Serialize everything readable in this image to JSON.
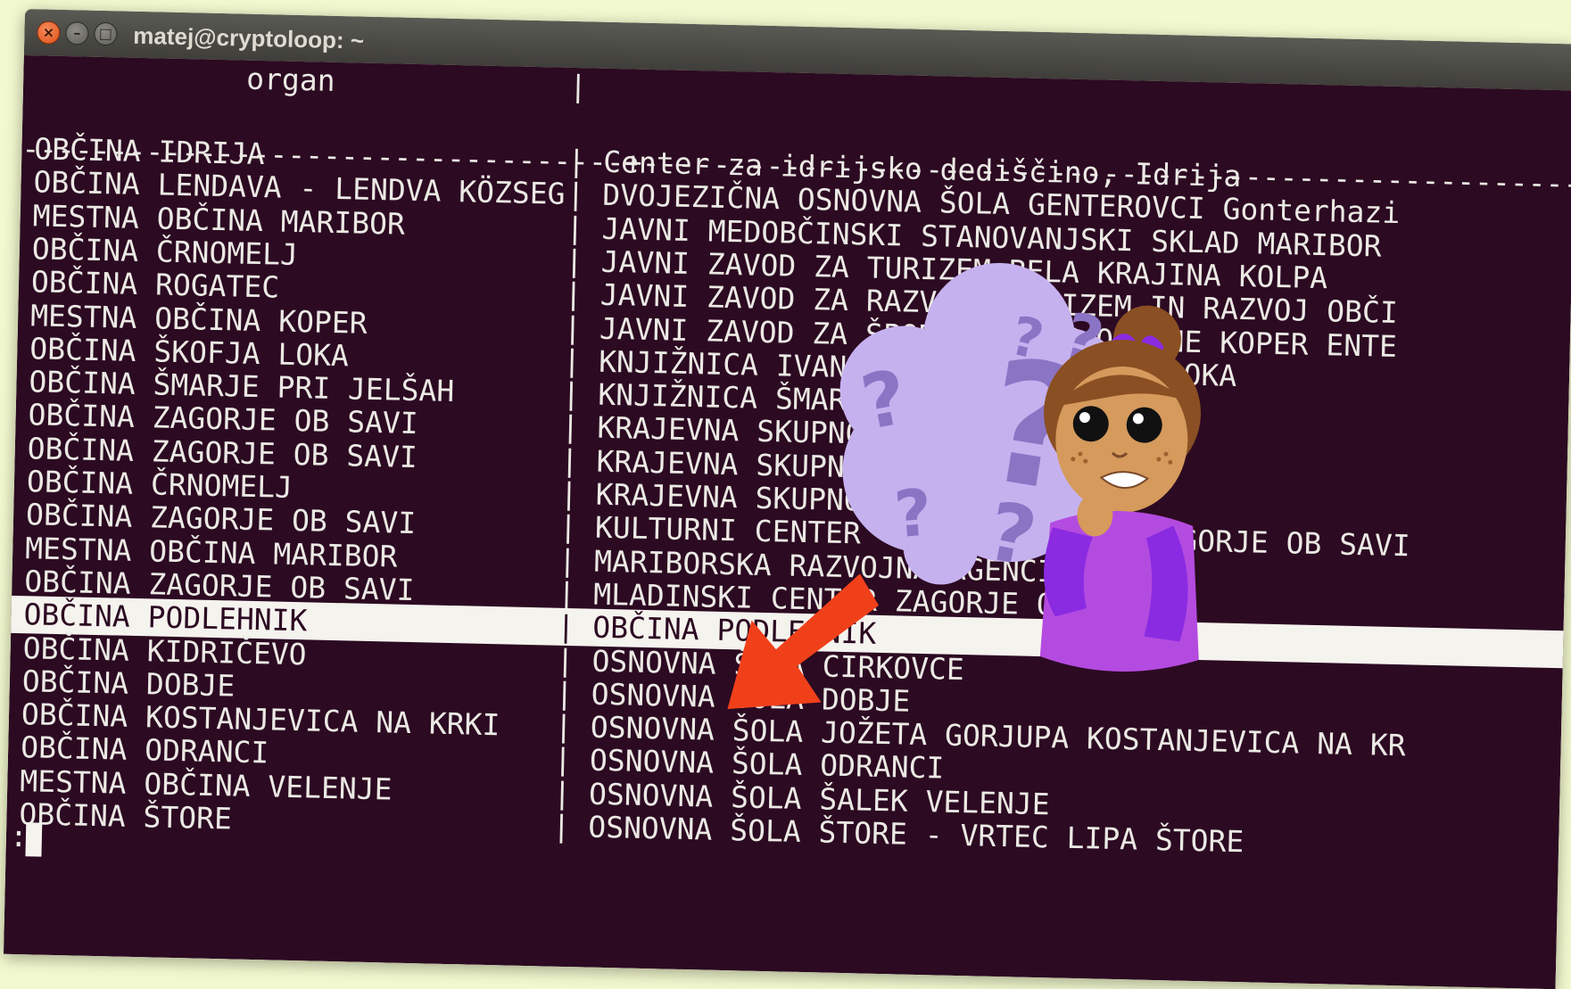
{
  "window": {
    "title": "matej@cryptoloop: ~",
    "close_glyph": "×",
    "minimize_glyph": "–",
    "maximize_glyph": "□"
  },
  "table": {
    "header": "organ",
    "header_separator": "|",
    "rule": "----------------------------------+------------------------------------------------------",
    "column_separator": "|",
    "rows": [
      {
        "c1": "OBČINA IDRIJA",
        "c2": "Center za idrijsko dediščino, Idrija"
      },
      {
        "c1": "OBČINA LENDAVA - LENDVA KÖZSEG",
        "c2": "DVOJEZIČNA OSNOVNA ŠOLA GENTEROVCI Gonterhazi"
      },
      {
        "c1": "MESTNA OBČINA MARIBOR",
        "c2": "JAVNI MEDOBČINSKI STANOVANJSKI SKLAD MARIBOR"
      },
      {
        "c1": "OBČINA ČRNOMELJ",
        "c2": "JAVNI ZAVOD ZA TURIZEM BELA KRAJINA KOLPA"
      },
      {
        "c1": "OBČINA ROGATEC",
        "c2": "JAVNI ZAVOD ZA RAZVOJ, TURIZEM IN RAZVOJ OBČI"
      },
      {
        "c1": "MESTNA OBČINA KOPER",
        "c2": "JAVNI ZAVOD ZA ŠPORT MESTNE OBČINE KOPER ENTE"
      },
      {
        "c1": "OBČINA ŠKOFJA LOKA",
        "c2": "KNJIŽNICA IVANA TAVČARJA ŠKOFJA LOKA"
      },
      {
        "c1": "OBČINA ŠMARJE PRI JELŠAH",
        "c2": "KNJIŽNICA ŠMARJE PRI JELŠAH"
      },
      {
        "c1": "OBČINA ZAGORJE OB SAVI",
        "c2": "KRAJEVNA SKUPNOST KISOVEC"
      },
      {
        "c1": "OBČINA ZAGORJE OB SAVI",
        "c2": "KRAJEVNA SKUPNOST LOKE - KOLOVRAT"
      },
      {
        "c1": "OBČINA ČRNOMELJ",
        "c2": "KRAJEVNA SKUPNOST TANČA GORA"
      },
      {
        "c1": "OBČINA ZAGORJE OB SAVI",
        "c2": "KULTURNI CENTER - DELAVSKI DOM ZAGORJE OB SAVI"
      },
      {
        "c1": "MESTNA OBČINA MARIBOR",
        "c2": "MARIBORSKA RAZVOJNA AGENCIJA p.o."
      },
      {
        "c1": "OBČINA ZAGORJE OB SAVI",
        "c2": "MLADINSKI CENTER ZAGORJE OB SAVI"
      },
      {
        "c1": "OBČINA PODLEHNIK",
        "c2": "OBČINA PODLEHNIK",
        "selected": true
      },
      {
        "c1": "OBČINA KIDRIČEVO",
        "c2": "OSNOVNA ŠOLA CIRKOVCE"
      },
      {
        "c1": "OBČINA DOBJE",
        "c2": "OSNOVNA ŠOLA DOBJE"
      },
      {
        "c1": "OBČINA KOSTANJEVICA NA KRKI",
        "c2": "OSNOVNA ŠOLA JOŽETA GORJUPA KOSTANJEVICA NA KR"
      },
      {
        "c1": "OBČINA ODRANCI",
        "c2": "OSNOVNA ŠOLA ODRANCI"
      },
      {
        "c1": "MESTNA OBČINA VELENJE",
        "c2": "OSNOVNA ŠOLA ŠALEK VELENJE"
      },
      {
        "c1": "OBČINA ŠTORE",
        "c2": "OSNOVNA ŠOLA ŠTORE - VRTEC LIPA ŠTORE"
      }
    ]
  },
  "prompt": ":",
  "illustration": {
    "mascot": "confused-girl-with-question-marks",
    "arrow": "red-arrow-pointing-down-left",
    "colors": {
      "cloud": "#c6b1ef",
      "question_marks": "#8b74c4",
      "hair": "#8a4f22",
      "skin": "#d59a5c",
      "shirt": "#b44be0",
      "bow": "#8a2be2",
      "arrow": "#f0401a"
    }
  },
  "colors": {
    "terminal_bg": "#2c0a22",
    "terminal_fg": "#ebe9e4",
    "titlebar": "#4a4945",
    "page_bg": "#f3f9cf",
    "selection": "#f5f3ee"
  }
}
